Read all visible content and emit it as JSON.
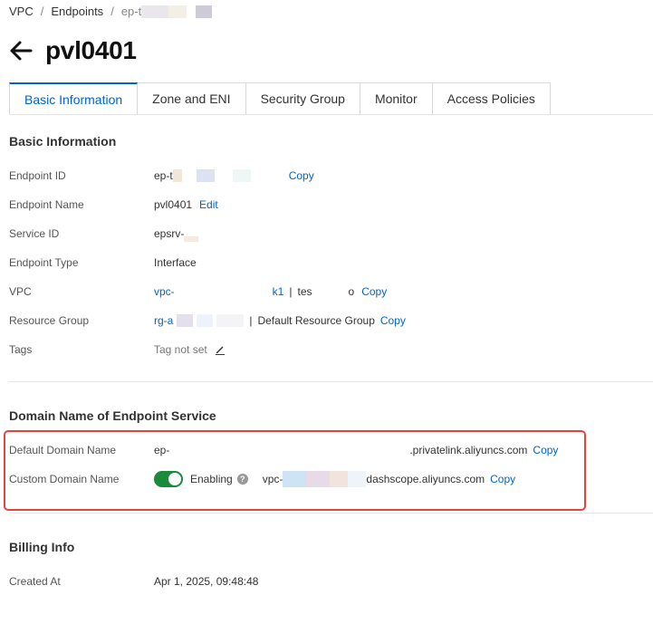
{
  "breadcrumb": {
    "items": [
      "VPC",
      "Endpoints",
      "ep-t"
    ],
    "separator": "/"
  },
  "header": {
    "title": "pvl0401"
  },
  "tabs": [
    {
      "label": "Basic Information",
      "active": true
    },
    {
      "label": "Zone and ENI",
      "active": false
    },
    {
      "label": "Security Group",
      "active": false
    },
    {
      "label": "Monitor",
      "active": false
    },
    {
      "label": "Access Policies",
      "active": false
    }
  ],
  "basic": {
    "title": "Basic Information",
    "endpoint_id": {
      "label": "Endpoint ID",
      "value": "ep-t",
      "copy": "Copy"
    },
    "endpoint_name": {
      "label": "Endpoint Name",
      "value": "pvl0401",
      "edit": "Edit"
    },
    "service_id": {
      "label": "Service ID",
      "value": "epsrv-"
    },
    "endpoint_type": {
      "label": "Endpoint Type",
      "value": "Interface"
    },
    "vpc": {
      "label": "VPC",
      "id_prefix": "vpc-",
      "id_suffix": "k1",
      "sep": "|",
      "name_prefix": "tes",
      "name_suffix": "o",
      "copy": "Copy"
    },
    "resource_group": {
      "label": "Resource Group",
      "id_prefix": "rg-a",
      "sep": "|",
      "name": "Default Resource Group",
      "copy": "Copy"
    },
    "tags": {
      "label": "Tags",
      "value": "Tag not set"
    }
  },
  "domain": {
    "title": "Domain Name of Endpoint Service",
    "default": {
      "label": "Default Domain Name",
      "prefix": "ep-",
      "suffix": ".privatelink.aliyuncs.com",
      "copy": "Copy"
    },
    "custom": {
      "label": "Custom Domain Name",
      "status": "Enabling",
      "help": "?",
      "prefix": "vpc-",
      "suffix": "dashscope.aliyuncs.com",
      "copy": "Copy"
    }
  },
  "billing": {
    "title": "Billing Info",
    "created_at": {
      "label": "Created At",
      "value": "Apr 1, 2025, 09:48:48"
    }
  },
  "colors": {
    "accent": "#0064c8",
    "toggle_on": "#1a8a3b",
    "highlight": "#e0453a"
  }
}
